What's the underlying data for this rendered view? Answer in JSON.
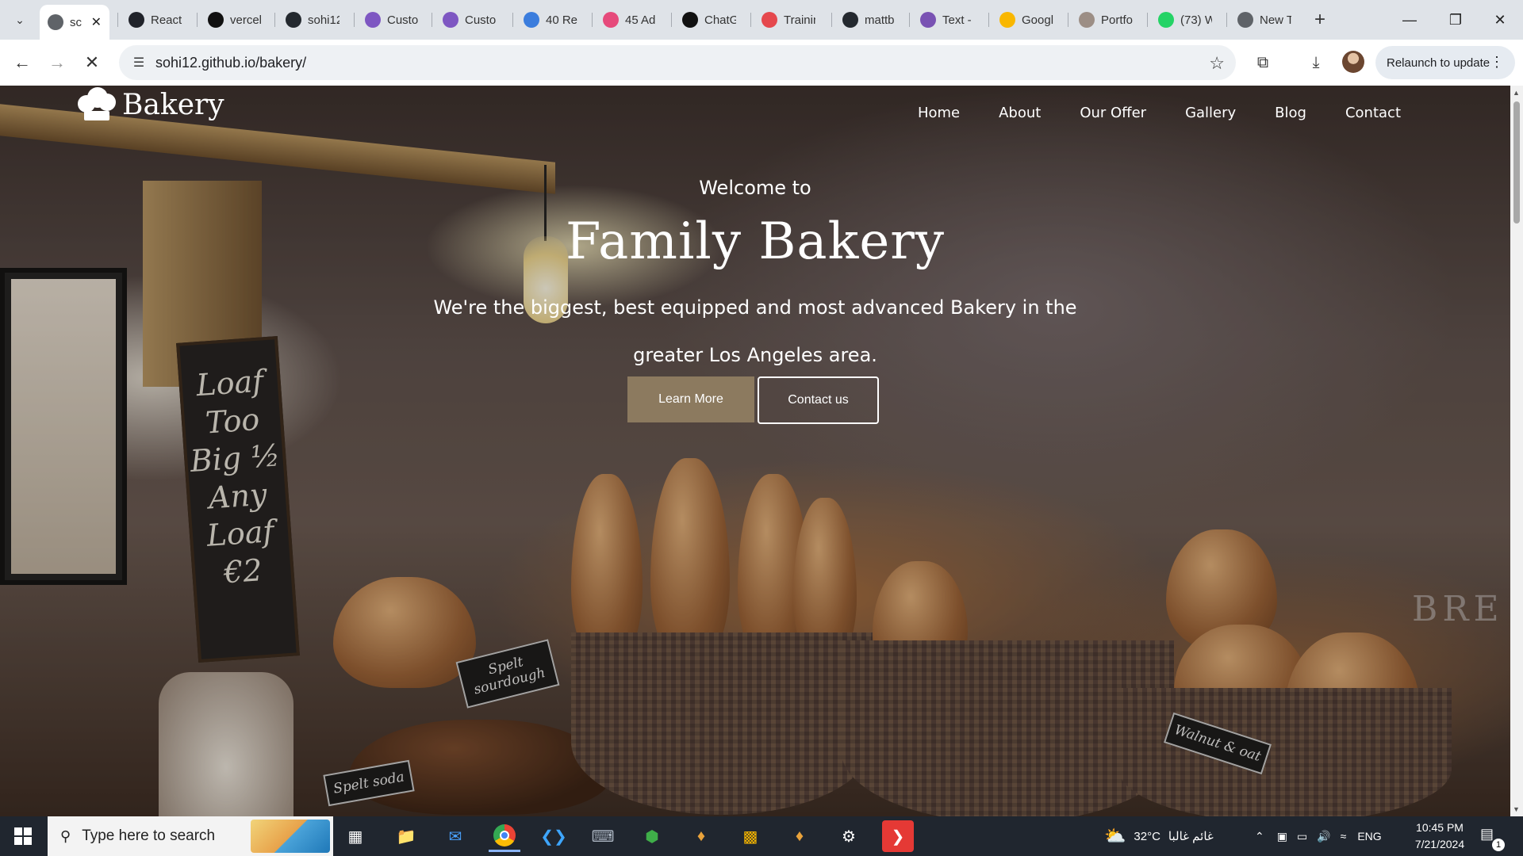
{
  "browser": {
    "tabs": [
      {
        "title": "sc",
        "icon": "loading-icon",
        "color": "#5f6368",
        "active": true
      },
      {
        "title": "React",
        "icon": "react-icon",
        "color": "#20232a"
      },
      {
        "title": "vercel",
        "icon": "vercel-icon",
        "color": "#111111"
      },
      {
        "title": "sohi12",
        "icon": "github-icon",
        "color": "#24292f"
      },
      {
        "title": "Custo",
        "icon": "vite-icon",
        "color": "#7e57c2"
      },
      {
        "title": "Custo",
        "icon": "vite-icon",
        "color": "#7e57c2"
      },
      {
        "title": "40 Re",
        "icon": "bookmark-icon",
        "color": "#3b7ddd"
      },
      {
        "title": "45 Ad",
        "icon": "bookmark-icon",
        "color": "#e64a7b"
      },
      {
        "title": "ChatG",
        "icon": "chatgpt-icon",
        "color": "#111111"
      },
      {
        "title": "Trainin",
        "icon": "training-icon",
        "color": "#e5484d"
      },
      {
        "title": "mattb",
        "icon": "github-icon",
        "color": "#24292f"
      },
      {
        "title": "Text -",
        "icon": "bootstrap-icon",
        "color": "#7952b3"
      },
      {
        "title": "Googl",
        "icon": "google-keep-icon",
        "color": "#f9b700"
      },
      {
        "title": "Portfo",
        "icon": "portfolio-icon",
        "color": "#9c8e85"
      },
      {
        "title": "(73) W",
        "icon": "whatsapp-icon",
        "color": "#25d366"
      },
      {
        "title": "New T",
        "icon": "chrome-icon",
        "color": "#5f6368"
      }
    ],
    "url": "sohi12.github.io/bakery/",
    "relaunch_label": "Relaunch to update"
  },
  "site": {
    "brand": "Bakery",
    "nav": [
      "Home",
      "About",
      "Our Offer",
      "Gallery",
      "Blog",
      "Contact"
    ],
    "hero": {
      "welcome": "Welcome to",
      "title": "Family Bakery",
      "subtitle": "We're the biggest, best equipped and most advanced Bakery in the greater Los Angeles area.",
      "learn_more": "Learn More",
      "contact_us": "Contact us"
    },
    "photo_text": {
      "chalkboard": "Loaf Too Big ½ Any Loaf €2",
      "card1": "Spelt sourdough",
      "card2": "Spelt soda",
      "card3": "Walnut & oat",
      "oven": "BRE"
    },
    "accent": "#8c7a5f"
  },
  "taskbar": {
    "search_placeholder": "Type here to search",
    "weather": "32°C",
    "weather_desc": "غائم غالبا",
    "lang": "ENG",
    "time": "10:45 PM",
    "date": "7/21/2024",
    "notifications": "1"
  }
}
